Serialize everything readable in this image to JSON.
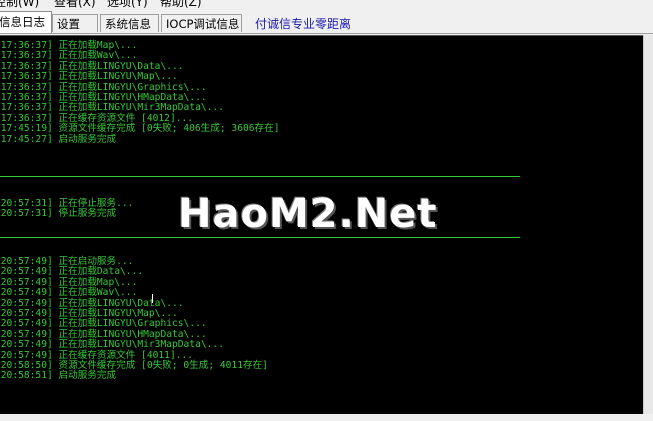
{
  "menu": {
    "items": [
      "控制(W)",
      "查看(X)",
      "选项(Y)",
      "帮助(Z)"
    ]
  },
  "tabs": {
    "items": [
      "信息日志",
      "设置",
      "系统信息",
      "IOCP调试信息"
    ],
    "active_index": 0,
    "link_text": "付诚信专业零距离"
  },
  "log": {
    "block1": [
      "[17:36:37] 正在加载Map\\...",
      "[17:36:37] 正在加载Wav\\...",
      "[17:36:37] 正在加载LINGYU\\Data\\...",
      "[17:36:37] 正在加载LINGYU\\Map\\...",
      "[17:36:37] 正在加载LINGYU\\Graphics\\...",
      "[17:36:37] 正在加载LINGYU\\HMapData\\...",
      "[17:36:37] 正在加载LINGYU\\Mir3MapData\\...",
      "[17:36:37] 正在缓存资源文件 [4012]...",
      "[17:45:19] 资源文件缓存完成 [0失败; 406生成; 3606存在]",
      "[17:45:27] 启动服务完成"
    ],
    "block2": [
      "[20:57:31] 正在停止服务...",
      "[20:57:31] 停止服务完成"
    ],
    "block3": [
      "[20:57:49] 正在启动服务...",
      "[20:57:49] 正在加载Data\\...",
      "[20:57:49] 正在加载Map\\...",
      "[20:57:49] 正在加载Wav\\...",
      "[20:57:49] 正在加载LINGYU\\Data\\...",
      "[20:57:49] 正在加载LINGYU\\Map\\...",
      "[20:57:49] 正在加载LINGYU\\Graphics\\...",
      "[20:57:49] 正在加载LINGYU\\HMapData\\...",
      "[20:57:49] 正在加载LINGYU\\Mir3MapData\\...",
      "[20:57:49] 正在缓存资源文件 [4011]...",
      "[20:58:50] 资源文件缓存完成 [0失败; 0生成; 4011存在]",
      "[20:58:51] 启动服务完成"
    ]
  },
  "watermark": "HaoM2.Net",
  "colors": {
    "console_bg": "#000000",
    "log_text": "#37c837",
    "link": "#1a1aa8"
  }
}
